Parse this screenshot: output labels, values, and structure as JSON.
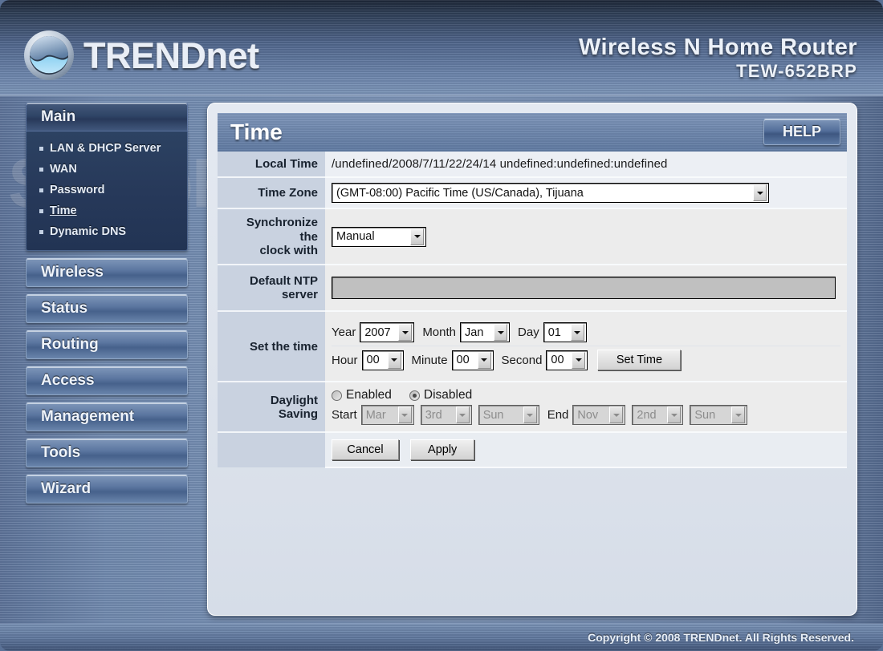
{
  "header": {
    "brand_upper": "TREND",
    "brand_lower": "net",
    "logo_icon": "trendnet-globe-icon",
    "product_name": "Wireless N Home Router",
    "model": "TEW-652BRP"
  },
  "watermark": "SetupRouter.com",
  "sidebar": {
    "sections": [
      {
        "label": "Main",
        "active": true,
        "items": [
          {
            "label": "LAN & DHCP Server",
            "current": false
          },
          {
            "label": "WAN",
            "current": false
          },
          {
            "label": "Password",
            "current": false
          },
          {
            "label": "Time",
            "current": true
          },
          {
            "label": "Dynamic DNS",
            "current": false
          }
        ]
      },
      {
        "label": "Wireless",
        "active": false,
        "items": []
      },
      {
        "label": "Status",
        "active": false,
        "items": []
      },
      {
        "label": "Routing",
        "active": false,
        "items": []
      },
      {
        "label": "Access",
        "active": false,
        "items": []
      },
      {
        "label": "Management",
        "active": false,
        "items": []
      },
      {
        "label": "Tools",
        "active": false,
        "items": []
      },
      {
        "label": "Wizard",
        "active": false,
        "items": []
      }
    ]
  },
  "panel": {
    "title": "Time",
    "help_label": "HELP"
  },
  "form": {
    "local_time": {
      "label": "Local Time",
      "value": "/undefined/2008/7/11/22/24/14 undefined:undefined:undefined"
    },
    "time_zone": {
      "label": "Time Zone",
      "value": "(GMT-08:00) Pacific Time (US/Canada), Tijuana"
    },
    "sync_clock": {
      "label_line1": "Synchronize",
      "label_line2": "the",
      "label_line3": "clock with",
      "value": "Manual"
    },
    "ntp_server": {
      "label_line1": "Default NTP",
      "label_line2": "server",
      "value": "",
      "disabled": true
    },
    "set_time": {
      "label": "Set the time",
      "year_label": "Year",
      "year_value": "2007",
      "month_label": "Month",
      "month_value": "Jan",
      "day_label": "Day",
      "day_value": "01",
      "hour_label": "Hour",
      "hour_value": "00",
      "minute_label": "Minute",
      "minute_value": "00",
      "second_label": "Second",
      "second_value": "00",
      "set_time_button": "Set Time"
    },
    "daylight_saving": {
      "label_line1": "Daylight",
      "label_line2": "Saving",
      "enabled_label": "Enabled",
      "disabled_label": "Disabled",
      "selected": "Disabled",
      "start_label": "Start",
      "start_month": "Mar",
      "start_week": "3rd",
      "start_day": "Sun",
      "end_label": "End",
      "end_month": "Nov",
      "end_week": "2nd",
      "end_day": "Sun",
      "controls_disabled": true
    },
    "actions": {
      "cancel_label": "Cancel",
      "apply_label": "Apply"
    }
  },
  "footer": {
    "copyright": "Copyright © 2008 TRENDnet. All Rights Reserved."
  }
}
